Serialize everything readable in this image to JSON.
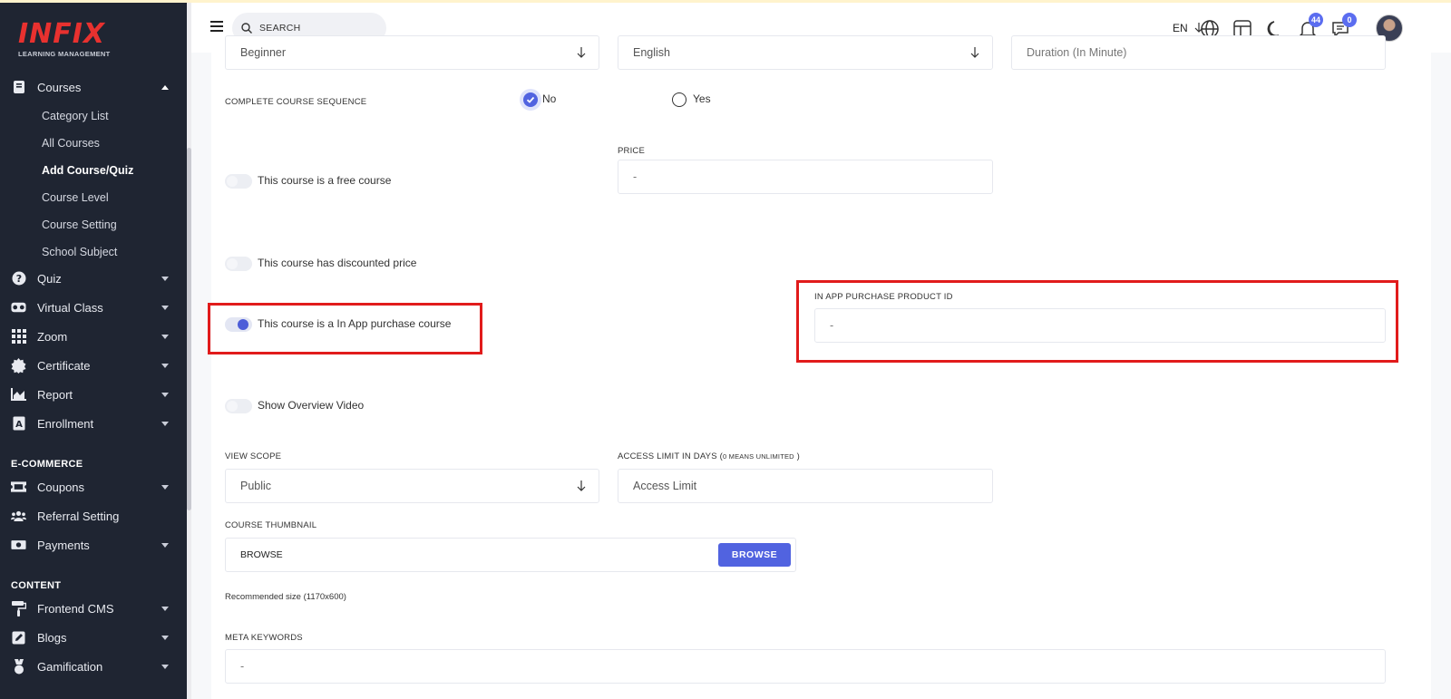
{
  "brand": {
    "logo_text": "INFIX",
    "logo_sub": "LEARNING MANAGEMENT"
  },
  "sidebar": {
    "courses": {
      "label": "Courses",
      "icon": "book-icon"
    },
    "course_sub": [
      "Category List",
      "All Courses",
      "Add Course/Quiz",
      "Course Level",
      "Course Setting",
      "School Subject"
    ],
    "items": [
      {
        "label": "Quiz",
        "icon": "question-circle-icon"
      },
      {
        "label": "Virtual Class",
        "icon": "vr-headset-icon"
      },
      {
        "label": "Zoom",
        "icon": "grid-icon"
      },
      {
        "label": "Certificate",
        "icon": "certificate-icon"
      },
      {
        "label": "Report",
        "icon": "chart-area-icon"
      },
      {
        "label": "Enrollment",
        "icon": "enrollment-icon"
      }
    ],
    "section_ecommerce": "E-COMMERCE",
    "ecommerce_items": [
      {
        "label": "Coupons",
        "icon": "ticket-icon"
      },
      {
        "label": "Referral Setting",
        "icon": "users-icon"
      },
      {
        "label": "Payments",
        "icon": "money-icon"
      }
    ],
    "section_content": "CONTENT",
    "content_items": [
      {
        "label": "Frontend CMS",
        "icon": "paint-roller-icon"
      },
      {
        "label": "Blogs",
        "icon": "edit-icon"
      },
      {
        "label": "Gamification",
        "icon": "medal-icon"
      }
    ]
  },
  "header": {
    "search_placeholder": "SEARCH",
    "lang": "EN",
    "notif_count": "44",
    "msg_count": "0"
  },
  "form": {
    "level_value": "Beginner",
    "language_value": "English",
    "duration_placeholder": "Duration (In Minute)",
    "complete_sequence_label": "COMPLETE COURSE SEQUENCE",
    "radio_no": "No",
    "radio_yes": "Yes",
    "price_label": "PRICE",
    "price_value": "-",
    "free_course_label": "This course is a free course",
    "discount_label": "This course has discounted price",
    "inapp_label": "This course is a In App purchase course",
    "inapp_id_label": "IN APP PURCHASE PRODUCT ID",
    "inapp_id_value": "-",
    "overview_label": "Show Overview Video",
    "view_scope_label": "VIEW SCOPE",
    "view_scope_value": "Public",
    "access_limit_label": "ACCESS LIMIT IN DAYS (",
    "access_limit_small": "0 MEANS UNLIMITED",
    "access_limit_close": " )",
    "access_limit_placeholder": "Access Limit",
    "thumbnail_label": "COURSE THUMBNAIL",
    "thumbnail_value": "BROWSE",
    "browse_button": "BROWSE",
    "recommended_size": "Recommended size (1170x600)",
    "meta_keywords_label": "META KEYWORDS",
    "meta_keywords_value": "-"
  },
  "colors": {
    "accent": "#5163e0",
    "sidebar_bg": "#1f2532",
    "highlight": "#e11b1b",
    "logo": "#e8312f"
  }
}
